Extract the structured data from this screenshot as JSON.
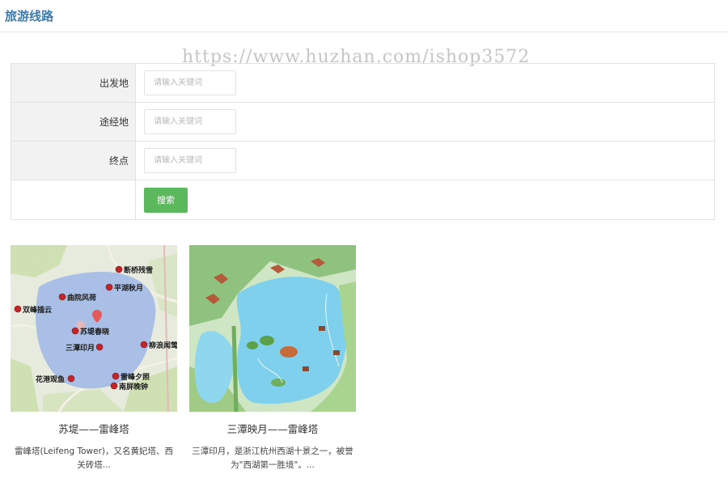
{
  "header": {
    "title": "旅游线路"
  },
  "watermark": {
    "text": "https://www.huzhan.com/ishop3572"
  },
  "search": {
    "fields": [
      {
        "label": "出发地",
        "placeholder": "请输入关键词",
        "value": ""
      },
      {
        "label": "途经地",
        "placeholder": "请输入关键词",
        "value": ""
      },
      {
        "label": "终点",
        "placeholder": "请输入关键词",
        "value": ""
      }
    ],
    "button_label": "搜索",
    "button_color": "#5cb85c"
  },
  "routes": [
    {
      "title": "苏堤——雷峰塔",
      "description": "雷峰塔(Leifeng Tower)，又名黄妃塔、西关砖塔...",
      "map_labels": [
        "断桥残雪",
        "平湖秋月",
        "曲院风荷",
        "双峰插云",
        "苏堤春晓",
        "三潭印月",
        "柳浪闻莺",
        "花港观鱼",
        "雷峰夕照",
        "南屏晚钟"
      ]
    },
    {
      "title": "三潭映月——雷峰塔",
      "description": "三潭印月，是浙江杭州西湖十景之一，被誉为\"西湖第一胜境\"。..."
    }
  ],
  "colors": {
    "title": "#3a7cb0",
    "lake": "#a9bfe6",
    "water": "#7fd0ec",
    "marker": "#c0262a"
  }
}
